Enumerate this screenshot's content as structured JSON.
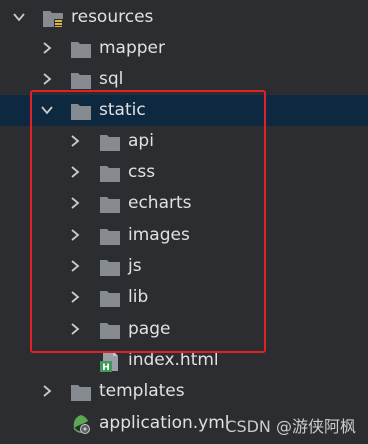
{
  "tree": {
    "root": {
      "label": "resources",
      "icon": "resources-folder-icon",
      "expanded": true
    },
    "items": [
      {
        "label": "mapper",
        "type": "folder",
        "expanded": false
      },
      {
        "label": "sql",
        "type": "folder",
        "expanded": false
      },
      {
        "label": "static",
        "type": "folder",
        "expanded": true,
        "selected": true,
        "children": [
          {
            "label": "api",
            "type": "folder",
            "expanded": false
          },
          {
            "label": "css",
            "type": "folder",
            "expanded": false
          },
          {
            "label": "echarts",
            "type": "folder",
            "expanded": false
          },
          {
            "label": "images",
            "type": "folder",
            "expanded": false
          },
          {
            "label": "js",
            "type": "folder",
            "expanded": false
          },
          {
            "label": "lib",
            "type": "folder",
            "expanded": false
          },
          {
            "label": "page",
            "type": "folder",
            "expanded": false
          },
          {
            "label": "index.html",
            "type": "file"
          }
        ]
      },
      {
        "label": "templates",
        "type": "folder",
        "expanded": false
      },
      {
        "label": "application.yml",
        "type": "file"
      }
    ]
  },
  "colors": {
    "background": "#2b2d30",
    "selection": "#0e293f",
    "highlight_border": "#e0212a",
    "folder": "#868a91",
    "text": "#dfe1e5"
  },
  "watermark": "CSDN @游侠阿枫"
}
